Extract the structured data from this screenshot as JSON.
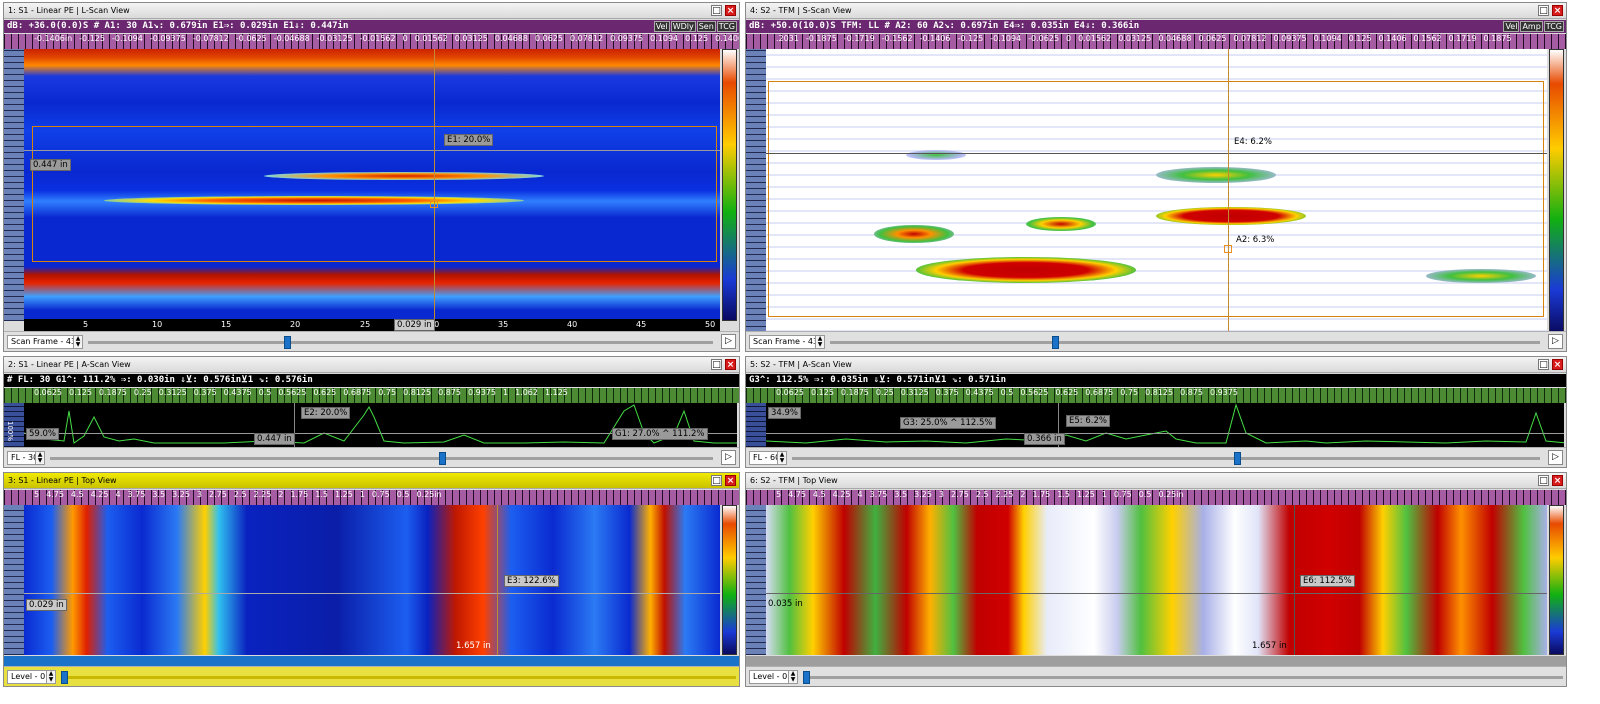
{
  "panels": {
    "p1": {
      "title": "1: S1 - Linear PE | L-Scan View",
      "info": "dB: +36.0(0.0)S  # A1: 30  A1↘: 0.679in  E1⇒: 0.029in  E1⇓: 0.447in",
      "tags": [
        "Vel",
        "WDly",
        "Sen",
        "TCG"
      ],
      "ruler": [
        "-0.1406in",
        "-0.125",
        "-0.1094",
        "-0.09375",
        "-0.07812",
        "-0.0625",
        "-0.04688",
        "-0.03125",
        "-0.01562",
        "0",
        "0.01562",
        "0.03125",
        "0.04688",
        "0.0625",
        "0.07812",
        "0.09375",
        "0.1094",
        "0.125",
        "0.1406"
      ],
      "xticks": [
        "5",
        "10",
        "15",
        "20",
        "25",
        "30",
        "35",
        "40",
        "45",
        "50"
      ],
      "label_e1": "E1: 20.0%",
      "label_depth": "0.447 in",
      "label_pos": "0.029 in",
      "footer": "Scan Frame - 43",
      "slider": 0.55
    },
    "p2": {
      "title": "2: S1 - Linear PE | A-Scan View",
      "info": "# FL: 30  G1^: 111.2%  ⇒: 0.030in  ⇓⊻: 0.576in⊻1    ⇘: 0.576in",
      "ruler": [
        "0.0625",
        "0.125",
        "0.1875",
        "0.25",
        "0.3125",
        "0.375",
        "0.4375",
        "0.5",
        "0.5625",
        "0.625",
        "0.6875",
        "0.75",
        "0.8125",
        "0.875",
        "0.9375",
        "1",
        "1.062",
        "1.125"
      ],
      "axis_pct": "100%",
      "label_pct": "59.0%",
      "label_e2": "E2: 20.0%",
      "label_depth": "0.447 in",
      "label_g1": "G1: 27.0% ^ 111.2%",
      "footer": "FL - 30",
      "slider": 0.6
    },
    "p3": {
      "title": "3: S1 - Linear PE | Top View",
      "ruler": [
        "5",
        "4.75",
        "4.5",
        "4.25",
        "4",
        "3.75",
        "3.5",
        "3.25",
        "3",
        "2.75",
        "2.5",
        "2.25",
        "2",
        "1.75",
        "1.5",
        "1.25",
        "1",
        "0.75",
        "0.5",
        "0.25in"
      ],
      "label_e3": "E3: 122.6%",
      "label_depth": "0.029 in",
      "label_pos": "1.657 in",
      "footer": "Level - 0",
      "progress": 1.0
    },
    "p4": {
      "title": "4: S2 - TFM | S-Scan View",
      "info": "dB: +50.0(10.0)S TFM: LL     # A2: 60  A2↘: 0.697in  E4⇒: 0.035in  E4⇓: 0.366in",
      "tags": [
        "Vel",
        "Amp",
        "TCG"
      ],
      "ruler": [
        ".2031",
        "-0.1875",
        "-0.1719",
        "-0.1562",
        "-0.1406",
        "-0.125",
        "-0.1094",
        "-0.0625",
        "0",
        "0.01562",
        "0.03125",
        "0.04688",
        "0.0625",
        "0.07812",
        "0.09375",
        "0.1094",
        "0.125",
        "0.1406",
        "0.1562",
        "0.1719",
        "0.1875"
      ],
      "label_e4": "E4: 6.2%",
      "label_a2": "A2: 6.3%",
      "footer": "Scan Frame - 43",
      "slider": 0.38
    },
    "p5": {
      "title": "5: S2 - TFM | A-Scan View",
      "info": "G3^: 112.5%  ⇒: 0.035in  ⇓⊻: 0.571in⊻1    ⇘: 0.571in",
      "ruler": [
        "0.0625",
        "0.125",
        "0.1875",
        "0.25",
        "0.3125",
        "0.375",
        "0.4375",
        "0.5",
        "0.5625",
        "0.625",
        "0.6875",
        "0.75",
        "0.8125",
        "0.875",
        "0.9375"
      ],
      "axis_pct": "100%",
      "label_pct": "34.9%",
      "label_g3": "G3: 25.0% ^ 112.5%",
      "label_e5": "E5: 6.2%",
      "label_depth": "0.366 in",
      "footer": "FL - 60",
      "slider": 0.6
    },
    "p6": {
      "title": "6: S2 - TFM | Top View",
      "ruler": [
        "5",
        "4.75",
        "4.5",
        "4.25",
        "4",
        "3.75",
        "3.5",
        "3.25",
        "3",
        "2.75",
        "2.5",
        "2.25",
        "2",
        "1.75",
        "1.5",
        "1.25",
        "1",
        "0.75",
        "0.5",
        "0.25in"
      ],
      "label_e6": "E6: 112.5%",
      "label_depth": "0.035 in",
      "label_pos": "1.657 in",
      "footer": "Level - 0",
      "progress": 1.0
    }
  },
  "colors": {
    "lscan_bg": "#0a2ad8",
    "sscan_bg": "#ffffff",
    "frame": "#d7820a",
    "ascan_trace": "#44dd44",
    "progress_blue": "#1b73c9",
    "progress_gray": "#9e9e9e"
  },
  "window_icons": [
    "maximize-icon",
    "close-icon"
  ]
}
